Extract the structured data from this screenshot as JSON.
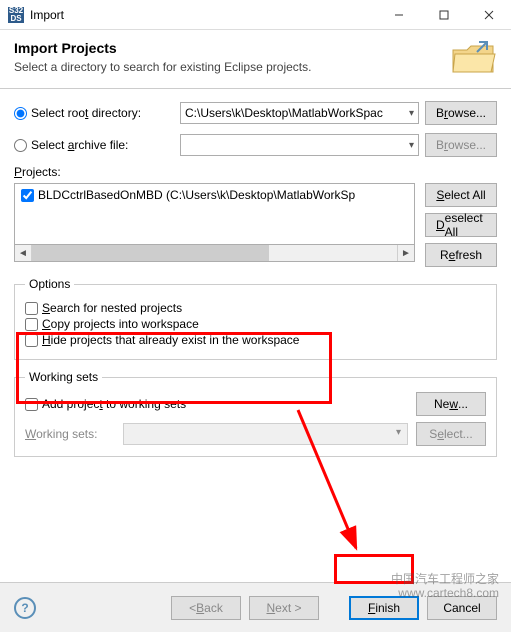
{
  "window": {
    "title": "Import",
    "app_icon_top": "S32",
    "app_icon_bottom": "DS"
  },
  "banner": {
    "heading": "Import Projects",
    "subheading": "Select a directory to search for existing Eclipse projects."
  },
  "source": {
    "root_label_prefix": "Select roo",
    "root_label_u": "t",
    "root_label_suffix": " directory:",
    "root_value": "C:\\Users\\k\\Desktop\\MatlabWorkSpac",
    "browse1_prefix": "B",
    "browse1_u": "r",
    "browse1_suffix": "owse...",
    "archive_label_prefix": "Select ",
    "archive_label_u": "a",
    "archive_label_suffix": "rchive file:",
    "browse2_prefix": "B",
    "browse2_u": "r",
    "browse2_suffix": "owse...",
    "root_selected": true
  },
  "projects": {
    "label_u": "P",
    "label_suffix": "rojects:",
    "items": [
      {
        "checked": true,
        "text": "BLDCctrlBasedOnMBD (C:\\Users\\k\\Desktop\\MatlabWorkSp"
      }
    ],
    "select_all_u": "S",
    "select_all_suffix": "elect All",
    "deselect_all_u": "D",
    "deselect_all_suffix": "eselect All",
    "refresh_prefix": "R",
    "refresh_u": "e",
    "refresh_suffix": "fresh"
  },
  "options": {
    "legend": "Options",
    "nested_u": "S",
    "nested_suffix": "earch for nested projects",
    "copy_u": "C",
    "copy_suffix": "opy projects into workspace",
    "hide_u": "H",
    "hide_suffix": "ide projects that already exist in the workspace"
  },
  "working_sets": {
    "legend": "Working sets",
    "add_prefix": "Add projec",
    "add_u": "t",
    "add_suffix": " to working sets",
    "new_label_prefix": "Ne",
    "new_label_u": "w",
    "new_label_suffix": "...",
    "ws_label_u": "W",
    "ws_label_suffix": "orking sets:",
    "select_prefix": "S",
    "select_u": "e",
    "select_suffix": "lect..."
  },
  "footer": {
    "back_u": "B",
    "back_suffix": "ack",
    "next_u": "N",
    "next_suffix": "ext >",
    "finish_u": "F",
    "finish_suffix": "inish",
    "cancel": "Cancel"
  },
  "watermark": {
    "line1": "中国汽车工程师之家",
    "line2": "www.cartech8.com"
  }
}
